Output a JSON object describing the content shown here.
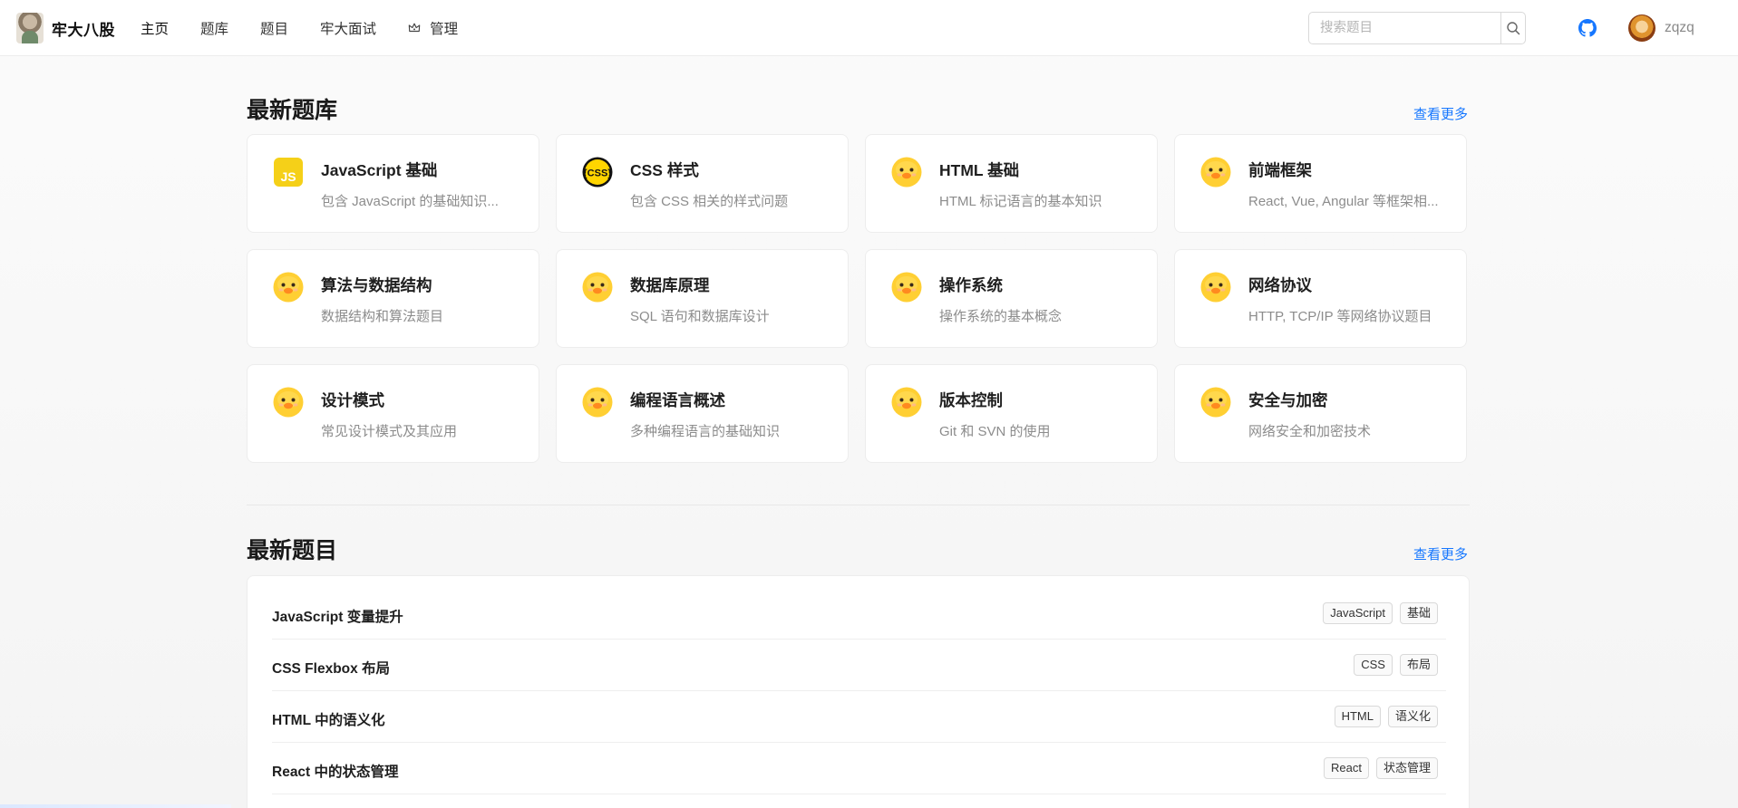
{
  "header": {
    "logo_text": "牢大八股",
    "nav": [
      {
        "label": "主页"
      },
      {
        "label": "题库"
      },
      {
        "label": "题目"
      },
      {
        "label": "牢大面试"
      },
      {
        "label": "管理"
      }
    ],
    "search": {
      "placeholder": "搜索题目",
      "value": ""
    },
    "username": "zqzq"
  },
  "banks": {
    "title": "最新题库",
    "more_label": "查看更多",
    "items": [
      {
        "title": "JavaScript 基础",
        "desc": "包含 JavaScript 的基础知识...",
        "icon": "js-icon"
      },
      {
        "title": "CSS 样式",
        "desc": "包含 CSS 相关的样式问题",
        "icon": "css-icon"
      },
      {
        "title": "HTML 基础",
        "desc": "HTML 标记语言的基本知识",
        "icon": "duck-icon"
      },
      {
        "title": "前端框架",
        "desc": "React, Vue, Angular 等框架相...",
        "icon": "duck-icon"
      },
      {
        "title": "算法与数据结构",
        "desc": "数据结构和算法题目",
        "icon": "duck-icon"
      },
      {
        "title": "数据库原理",
        "desc": "SQL 语句和数据库设计",
        "icon": "duck-icon"
      },
      {
        "title": "操作系统",
        "desc": "操作系统的基本概念",
        "icon": "duck-icon"
      },
      {
        "title": "网络协议",
        "desc": "HTTP, TCP/IP 等网络协议题目",
        "icon": "duck-icon"
      },
      {
        "title": "设计模式",
        "desc": "常见设计模式及其应用",
        "icon": "duck-icon"
      },
      {
        "title": "编程语言概述",
        "desc": "多种编程语言的基础知识",
        "icon": "duck-icon"
      },
      {
        "title": "版本控制",
        "desc": "Git 和 SVN 的使用",
        "icon": "duck-icon"
      },
      {
        "title": "安全与加密",
        "desc": "网络安全和加密技术",
        "icon": "duck-icon"
      }
    ]
  },
  "questions": {
    "title": "最新题目",
    "more_label": "查看更多",
    "items": [
      {
        "title": "JavaScript 变量提升",
        "tags": [
          "JavaScript",
          "基础"
        ]
      },
      {
        "title": "CSS Flexbox 布局",
        "tags": [
          "CSS",
          "布局"
        ]
      },
      {
        "title": "HTML 中的语义化",
        "tags": [
          "HTML",
          "语义化"
        ]
      },
      {
        "title": "React 中的状态管理",
        "tags": [
          "React",
          "状态管理"
        ]
      }
    ]
  },
  "colors": {
    "accent": "#1677ff",
    "duck": "#ffcf33"
  }
}
